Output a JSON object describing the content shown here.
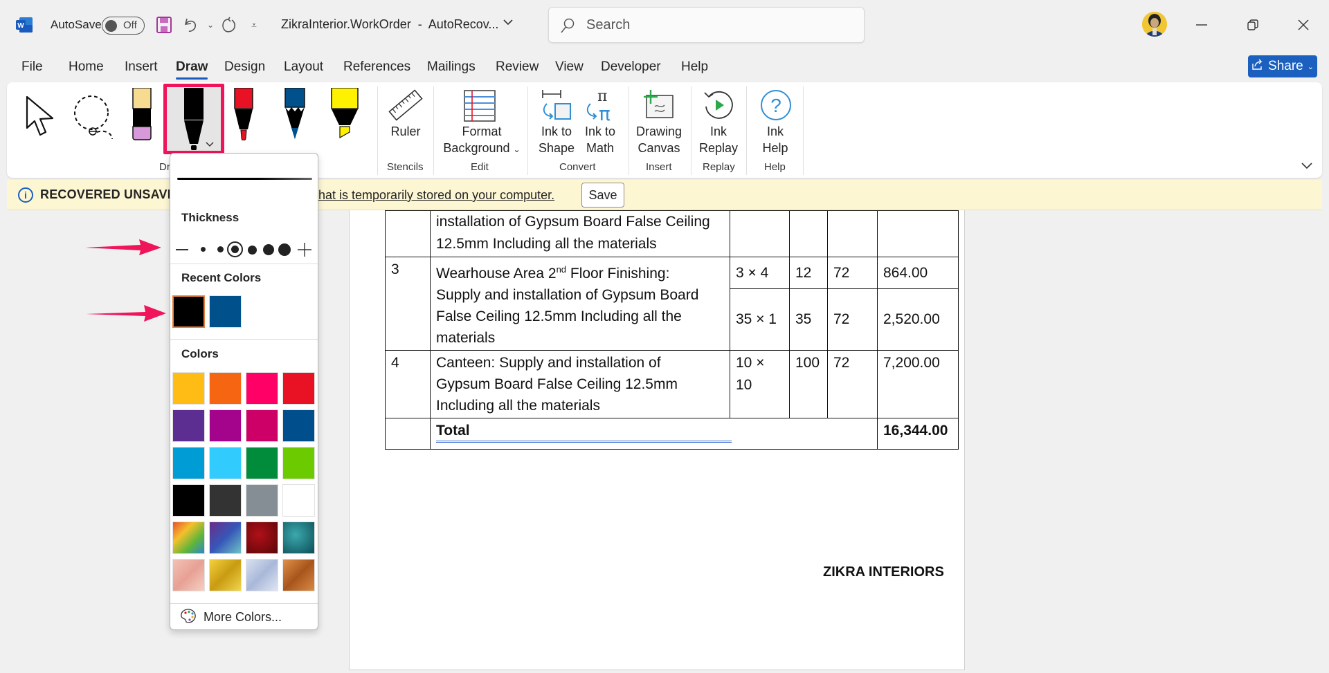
{
  "titlebar": {
    "app_icon": "word-icon",
    "autosave_label": "AutoSave",
    "autosave_state": "Off",
    "doc_title": "ZikraInterior.WorkOrder  -  AutoRecov...",
    "search_placeholder": "Search"
  },
  "menu": {
    "tabs": [
      "File",
      "Home",
      "Insert",
      "Draw",
      "Design",
      "Layout",
      "References",
      "Mailings",
      "Review",
      "View",
      "Developer",
      "Help"
    ],
    "active_tab": "Draw",
    "share_label": "Share"
  },
  "ribbon": {
    "tools": [
      "select-tool",
      "lasso-tool",
      "eraser",
      "pen-black",
      "pen-red",
      "pencil-blue",
      "highlighter-yellow"
    ],
    "drawing_tools_group": "Dr",
    "ruler_label": "Ruler",
    "stencils_group": "Stencils",
    "format_bg_line1": "Format",
    "format_bg_line2": "Background",
    "edit_group": "Edit",
    "ink_shape_line1": "Ink to",
    "ink_shape_line2": "Shape",
    "ink_math_line1": "Ink to",
    "ink_math_line2": "Math",
    "convert_group": "Convert",
    "canvas_line1": "Drawing",
    "canvas_line2": "Canvas",
    "insert_group": "Insert",
    "replay_line1": "Ink",
    "replay_line2": "Replay",
    "replay_group": "Replay",
    "help_line1": "Ink",
    "help_line2": "Help",
    "help_group": "Help"
  },
  "infobar": {
    "title": "RECOVERED UNSAVED",
    "message": "e that is temporarily stored on your computer.",
    "save_label": "Save"
  },
  "pen_menu": {
    "thickness_label": "Thickness",
    "thickness_levels": 6,
    "selected_thickness_index": 2,
    "recent_colors_label": "Recent Colors",
    "recent_colors": [
      "#000000",
      "#00508c"
    ],
    "selected_recent_color": "#000000",
    "colors_label": "Colors",
    "colors": [
      "#ffbc14",
      "#f66512",
      "#ff0066",
      "#e81224",
      "#5c2e91",
      "#a4038c",
      "#cc0066",
      "#004e8c",
      "#009cd6",
      "#32cbfd",
      "#008c3a",
      "#6ccb00",
      "#000000",
      "#333333",
      "#858e94",
      "#ffffff"
    ],
    "textures": [
      "rainbow",
      "galaxy",
      "lava",
      "ocean",
      "rose-gold",
      "gold",
      "silver",
      "bronze"
    ],
    "more_colors_label": "More Colors..."
  },
  "document": {
    "rows": [
      {
        "no": "",
        "desc": [
          "installation of Gypsum Board False Ceiling",
          "12.5mm Including all the materials"
        ],
        "dims": [
          ""
        ],
        "qty": [
          ""
        ],
        "rate": [
          ""
        ],
        "amount": [
          ""
        ]
      },
      {
        "no": "3",
        "desc_pre": "Wearhouse Area 2",
        "desc_sup": "nd",
        "desc_post": " Floor Finishing:",
        "desc": [
          "Supply and installation of Gypsum Board",
          "False Ceiling 12.5mm Including all the",
          "materials"
        ],
        "dims": [
          "3 × 4",
          "35 × 1"
        ],
        "qty": [
          "12",
          "35"
        ],
        "rate": [
          "72",
          "72"
        ],
        "amount": [
          "864.00",
          "2,520.00"
        ]
      },
      {
        "no": "4",
        "desc": [
          "Canteen: Supply and installation of",
          "Gypsum Board False Ceiling 12.5mm",
          "Including all the materials"
        ],
        "dims": [
          "10 × 10"
        ],
        "qty": [
          "100"
        ],
        "rate": [
          "72"
        ],
        "amount": [
          "7,200.00"
        ]
      }
    ],
    "total_label": "Total",
    "total_value": "16,344.00",
    "signature": "ZIKRA INTERIORS"
  }
}
